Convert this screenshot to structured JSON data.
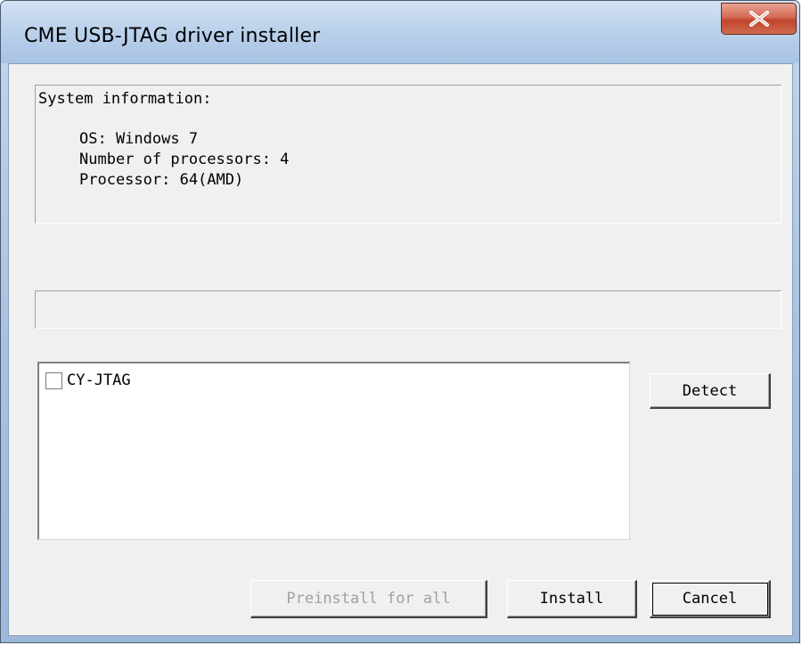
{
  "window": {
    "title": "CME USB-JTAG driver installer"
  },
  "system_info": {
    "heading": "System information:",
    "lines": [
      "OS: Windows 7",
      "Number of processors: 4",
      "Processor: 64(AMD)"
    ]
  },
  "progress": {
    "value_percent": 0
  },
  "device_list": {
    "items": [
      {
        "label": "CY-JTAG",
        "checked": false
      }
    ]
  },
  "buttons": {
    "detect": "Detect",
    "preinstall": "Preinstall for all",
    "install": "Install",
    "cancel": "Cancel"
  },
  "colors": {
    "titlebar": "#bcd2ec",
    "close_button": "#c0452c",
    "dialog_background": "#f0f0f0",
    "disabled_text": "#a0a0a0"
  },
  "icons": {
    "close": "close-icon"
  }
}
